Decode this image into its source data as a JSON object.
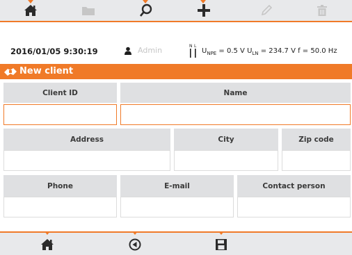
{
  "toolbar_top": {
    "buttons": [
      {
        "icon": "home-icon",
        "enabled": true
      },
      {
        "icon": "folder-icon",
        "enabled": false
      },
      {
        "icon": "search-icon",
        "enabled": true
      },
      {
        "icon": "plus-icon",
        "enabled": true
      },
      {
        "icon": "pencil-icon",
        "enabled": false
      },
      {
        "icon": "trash-icon",
        "enabled": false
      }
    ]
  },
  "status": {
    "datetime": "2016/01/05 9:30:19",
    "user": "Admin",
    "measurement": "U_NPE = 0.5 V U_LN = 234.7 V f = 50.0 Hz",
    "meas_parts": {
      "u1_label": "U",
      "u1_sub": "NPE",
      "u1_val": " = 0.5 V ",
      "u2_label": "U",
      "u2_sub": "LN",
      "u2_val": " = 234.7 V ",
      "f_val": "f = 50.0 Hz"
    },
    "plug_labels": {
      "n": "N",
      "l": "L"
    }
  },
  "form": {
    "title": "New client",
    "client_id_label": "Client ID",
    "client_id_value": "",
    "name_label": "Name",
    "name_value": "",
    "address_label": "Address",
    "address_value": "",
    "city_label": "City",
    "city_value": "",
    "zip_label": "Zip code",
    "zip_value": "",
    "phone_label": "Phone",
    "phone_value": "",
    "email_label": "E-mail",
    "email_value": "",
    "contact_label": "Contact person",
    "contact_value": ""
  },
  "toolbar_bottom": {
    "buttons": [
      {
        "icon": "home-icon"
      },
      {
        "icon": "back-icon"
      },
      {
        "icon": "save-icon"
      }
    ]
  },
  "colors": {
    "accent": "#f07a28",
    "toolbar_bg": "#e8e9eb",
    "header_cell": "#dfe0e2",
    "disabled": "#c6c6c6"
  }
}
